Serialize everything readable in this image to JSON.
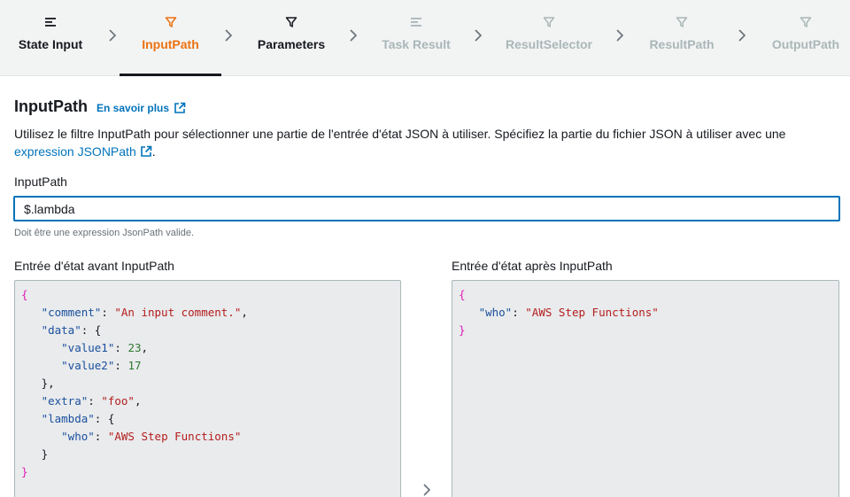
{
  "steps": [
    {
      "id": "state-input",
      "label": "State Input",
      "icon": "list-icon",
      "state": "done"
    },
    {
      "id": "inputpath",
      "label": "InputPath",
      "icon": "filter-icon",
      "state": "active"
    },
    {
      "id": "parameters",
      "label": "Parameters",
      "icon": "filter-icon",
      "state": "done"
    },
    {
      "id": "task-result",
      "label": "Task Result",
      "icon": "list-icon",
      "state": "future"
    },
    {
      "id": "resultselector",
      "label": "ResultSelector",
      "icon": "filter-icon",
      "state": "future"
    },
    {
      "id": "resultpath",
      "label": "ResultPath",
      "icon": "filter-icon",
      "state": "future"
    },
    {
      "id": "outputpath",
      "label": "OutputPath",
      "icon": "filter-icon",
      "state": "future"
    }
  ],
  "section": {
    "title": "InputPath",
    "learn_more": "En savoir plus",
    "description_text": "Utilisez le filtre InputPath pour sélectionner une partie de l'entrée d'état JSON à utiliser. Spécifiez la partie du fichier JSON à utiliser avec une ",
    "description_link": "expression JSONPath",
    "description_end": "."
  },
  "input": {
    "label": "InputPath",
    "value": "$.lambda",
    "hint": "Doit être une expression JsonPath valide."
  },
  "before": {
    "label": "Entrée d'état avant InputPath",
    "lines": [
      [
        {
          "t": "{",
          "c": "brace-c"
        }
      ],
      [
        {
          "t": "   ",
          "c": "punct"
        },
        {
          "t": "\"comment\"",
          "c": "key"
        },
        {
          "t": ": ",
          "c": "punct"
        },
        {
          "t": "\"An input comment.\"",
          "c": "str"
        },
        {
          "t": ",",
          "c": "punct"
        }
      ],
      [
        {
          "t": "   ",
          "c": "punct"
        },
        {
          "t": "\"data\"",
          "c": "key"
        },
        {
          "t": ": {",
          "c": "punct"
        }
      ],
      [
        {
          "t": "      ",
          "c": "punct"
        },
        {
          "t": "\"value1\"",
          "c": "key"
        },
        {
          "t": ": ",
          "c": "punct"
        },
        {
          "t": "23",
          "c": "num"
        },
        {
          "t": ",",
          "c": "punct"
        }
      ],
      [
        {
          "t": "      ",
          "c": "punct"
        },
        {
          "t": "\"value2\"",
          "c": "key"
        },
        {
          "t": ": ",
          "c": "punct"
        },
        {
          "t": "17",
          "c": "num"
        }
      ],
      [
        {
          "t": "   },",
          "c": "punct"
        }
      ],
      [
        {
          "t": "   ",
          "c": "punct"
        },
        {
          "t": "\"extra\"",
          "c": "key"
        },
        {
          "t": ": ",
          "c": "punct"
        },
        {
          "t": "\"foo\"",
          "c": "str"
        },
        {
          "t": ",",
          "c": "punct"
        }
      ],
      [
        {
          "t": "   ",
          "c": "punct"
        },
        {
          "t": "\"lambda\"",
          "c": "key"
        },
        {
          "t": ": {",
          "c": "punct"
        }
      ],
      [
        {
          "t": "      ",
          "c": "punct"
        },
        {
          "t": "\"who\"",
          "c": "key"
        },
        {
          "t": ": ",
          "c": "punct"
        },
        {
          "t": "\"AWS Step Functions\"",
          "c": "str"
        }
      ],
      [
        {
          "t": "   }",
          "c": "punct"
        }
      ],
      [
        {
          "t": "}",
          "c": "brace-c"
        }
      ]
    ]
  },
  "after": {
    "label": "Entrée d'état après InputPath",
    "lines": [
      [
        {
          "t": "{",
          "c": "brace-c"
        }
      ],
      [
        {
          "t": "   ",
          "c": "punct"
        },
        {
          "t": "\"who\"",
          "c": "key"
        },
        {
          "t": ": ",
          "c": "punct"
        },
        {
          "t": "\"AWS Step Functions\"",
          "c": "str"
        }
      ],
      [
        {
          "t": "}",
          "c": "brace-c"
        }
      ]
    ]
  },
  "colors": {
    "active": "#ec7211",
    "link": "#0073bb",
    "muted": "#aab7b8",
    "panel_bg": "#e9ebed"
  }
}
